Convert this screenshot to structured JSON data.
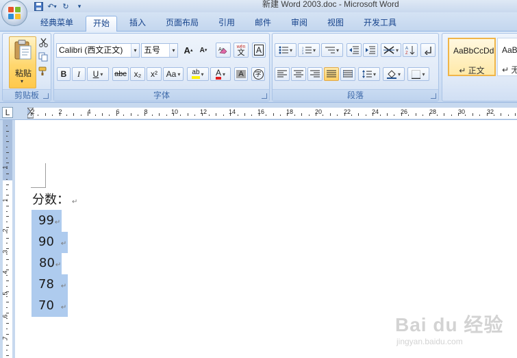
{
  "window": {
    "title": "新建 Word 2003.doc - Microsoft Word"
  },
  "tabs": [
    {
      "label": "经典菜单"
    },
    {
      "label": "开始"
    },
    {
      "label": "插入"
    },
    {
      "label": "页面布局"
    },
    {
      "label": "引用"
    },
    {
      "label": "邮件"
    },
    {
      "label": "审阅"
    },
    {
      "label": "视图"
    },
    {
      "label": "开发工具"
    }
  ],
  "active_tab": "开始",
  "clipboard": {
    "paste_label": "粘贴",
    "group_label": "剪贴板"
  },
  "font": {
    "font_name": "Calibri (西文正文)",
    "font_size": "五号",
    "group_label": "字体",
    "bold": "B",
    "italic": "I",
    "underline": "U",
    "strikethrough": "abc",
    "subscript": "x₂",
    "superscript": "x²",
    "change_case": "Aa",
    "highlight_glyph": "ab",
    "font_color_glyph": "A",
    "grow_glyph": "A",
    "shrink_glyph": "A",
    "char_border_glyph": "A",
    "char_shade_glyph": "A",
    "enclose_glyph": "字",
    "phonetic_glyph": "wén",
    "phonetic_char": "文"
  },
  "paragraph": {
    "group_label": "段落"
  },
  "styles": [
    {
      "sample": "AaBbCcDd",
      "name": "↵ 正文"
    },
    {
      "sample": "AaBb",
      "name": "↵ 无"
    }
  ],
  "ruler": {
    "tab_selector": "L",
    "h_numbers": [
      "2",
      "2",
      "4",
      "6",
      "8",
      "10",
      "12",
      "14",
      "16",
      "18",
      "20",
      "22",
      "24",
      "26",
      "28",
      "30",
      "32"
    ],
    "v_numbers": [
      "1",
      "1",
      "2",
      "3",
      "4",
      "5",
      "6",
      "7"
    ]
  },
  "document": {
    "heading": "分数：",
    "scores": [
      "99",
      "90",
      "80",
      "78",
      "70"
    ],
    "paragraph_mark": "↵"
  },
  "watermark": {
    "logo": "Bai du 经验",
    "url": "jingyan.baidu.com"
  }
}
